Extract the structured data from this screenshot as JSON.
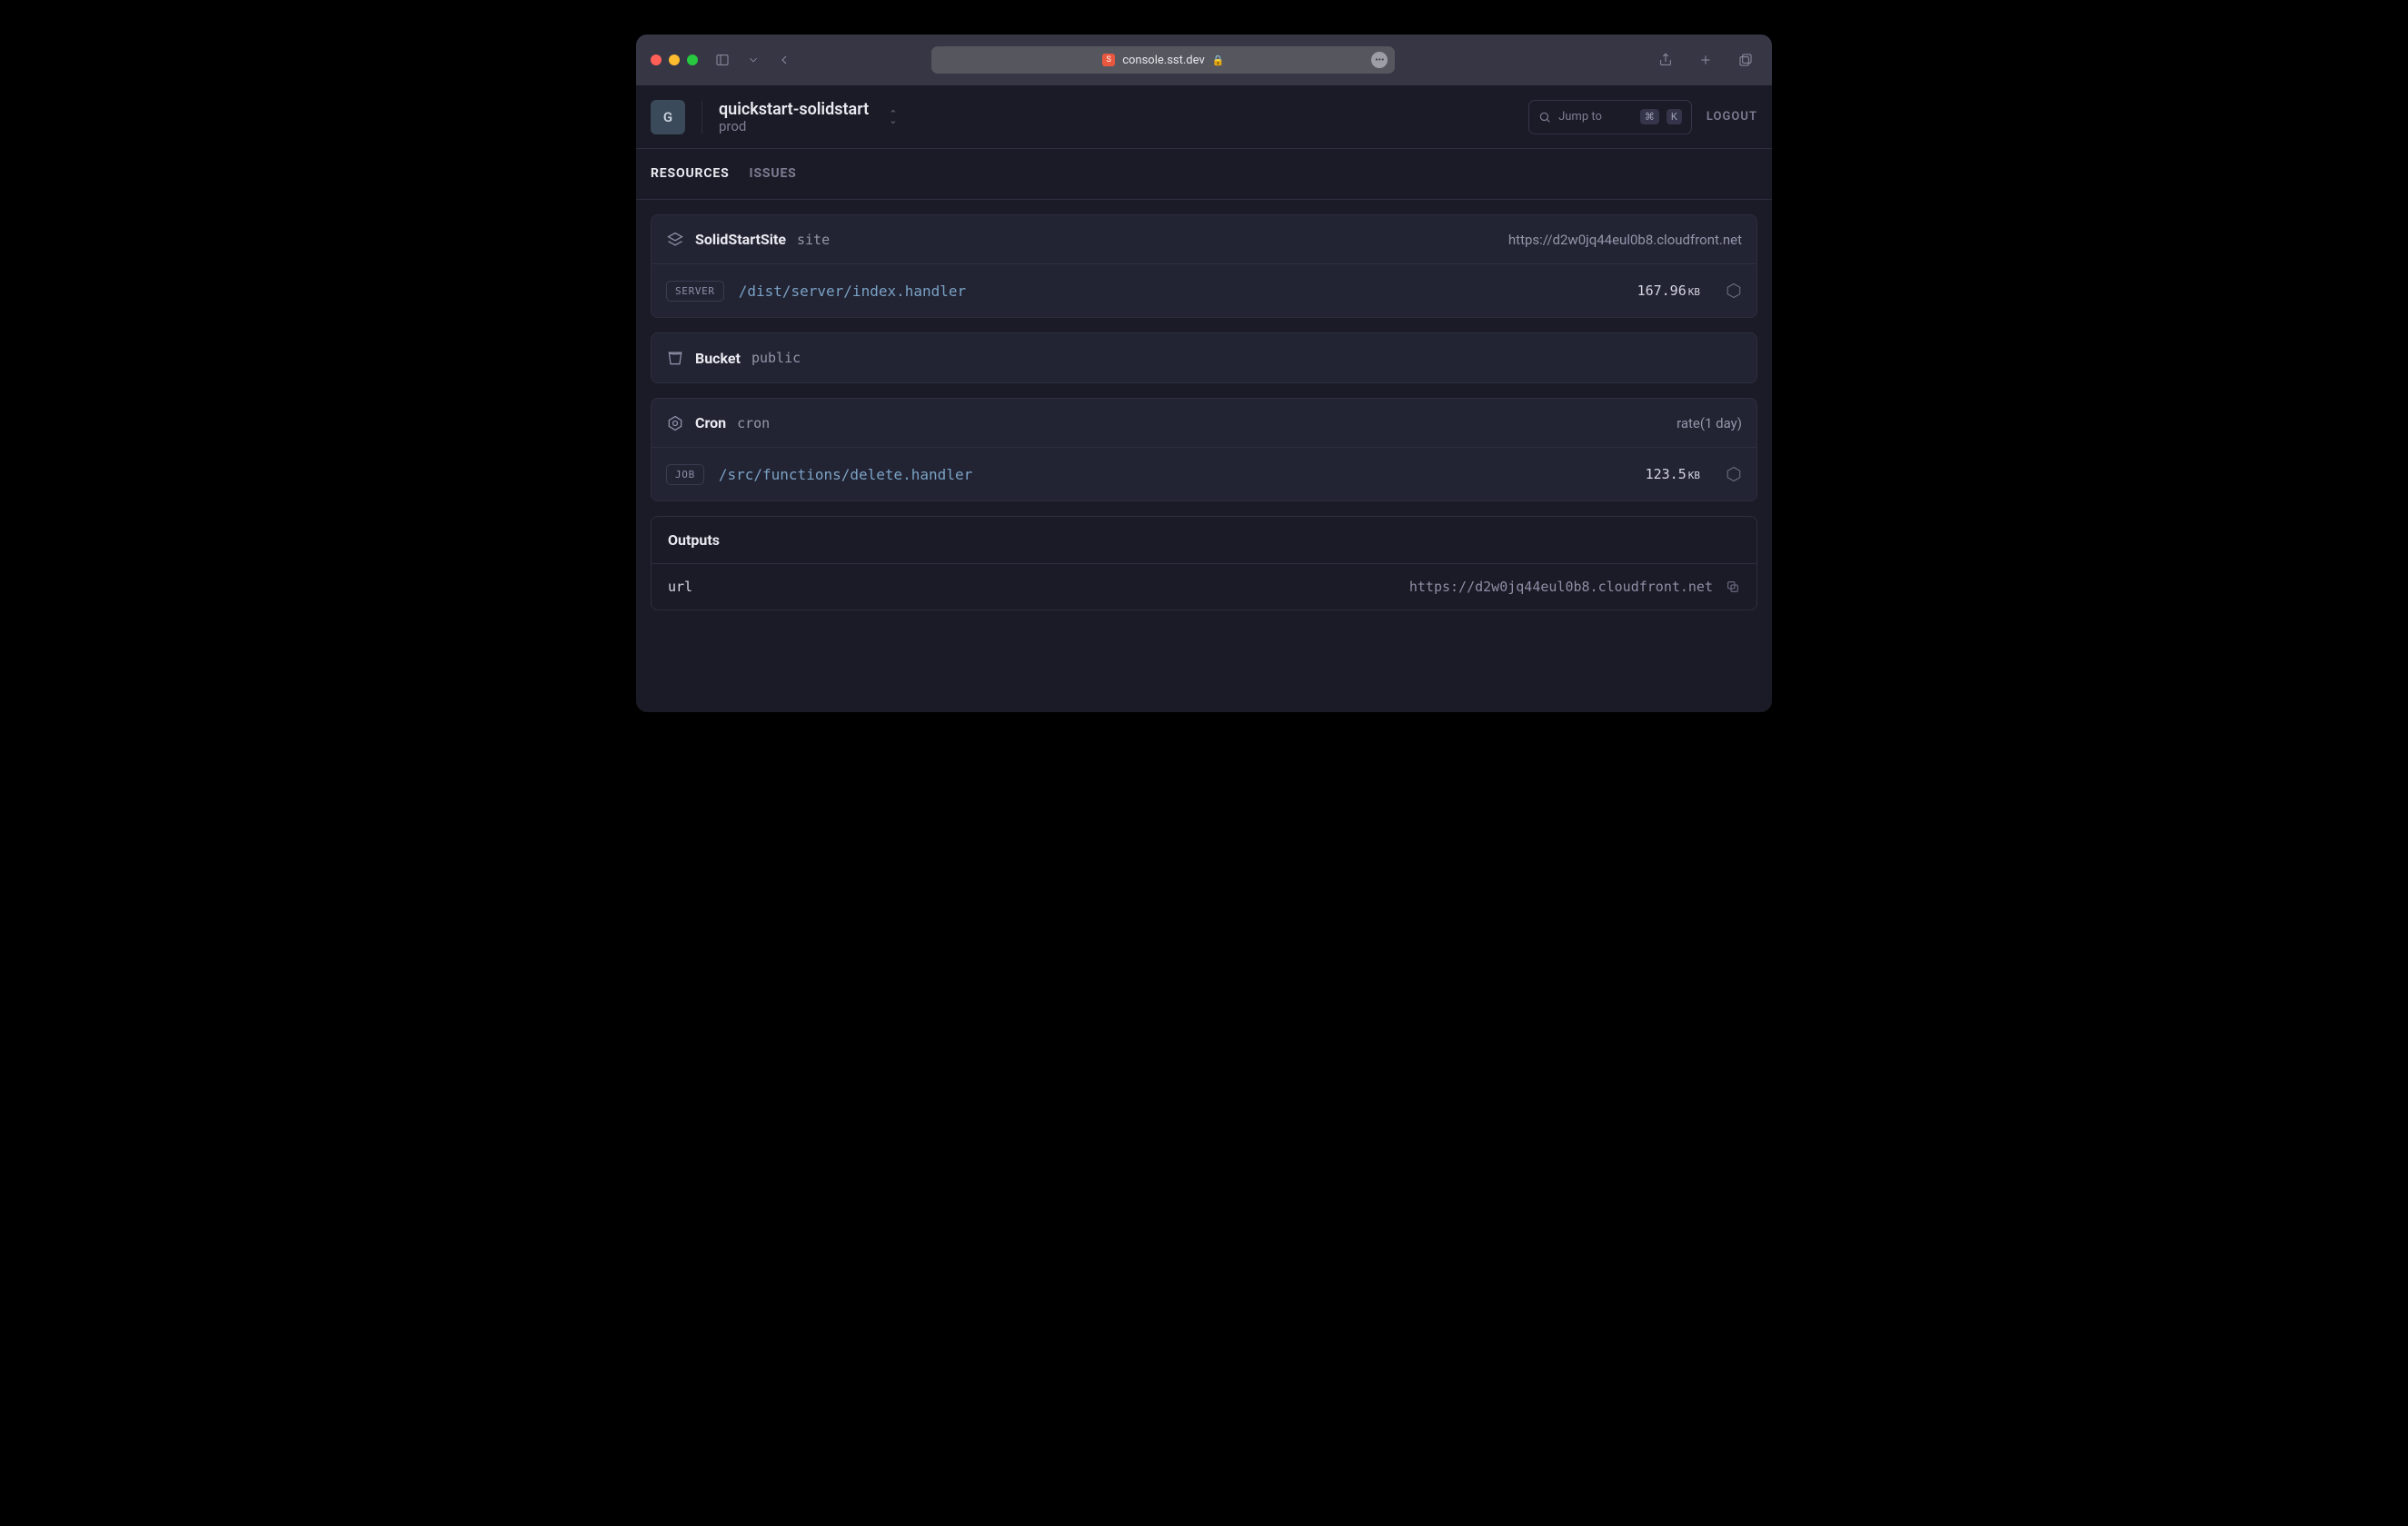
{
  "browser": {
    "url": "console.sst.dev"
  },
  "header": {
    "avatar_initial": "G",
    "project_name": "quickstart-solidstart",
    "stage": "prod",
    "jump_label": "Jump to",
    "jump_key1": "⌘",
    "jump_key2": "K",
    "logout": "LOGOUT"
  },
  "tabs": {
    "resources": "RESOURCES",
    "issues": "ISSUES"
  },
  "resources": [
    {
      "type": "SolidStartSite",
      "name": "site",
      "header_right": "https://d2w0jq44eul0b8.cloudfront.net",
      "row": {
        "tag": "SERVER",
        "handler": "/dist/server/index.handler",
        "size_value": "167.96",
        "size_unit": "KB"
      }
    },
    {
      "type": "Bucket",
      "name": "public"
    },
    {
      "type": "Cron",
      "name": "cron",
      "header_right": "rate(1 day)",
      "row": {
        "tag": "JOB",
        "handler": "/src/functions/delete.handler",
        "size_value": "123.5",
        "size_unit": "KB"
      }
    }
  ],
  "outputs": {
    "title": "Outputs",
    "items": [
      {
        "key": "url",
        "value": "https://d2w0jq44eul0b8.cloudfront.net"
      }
    ]
  }
}
